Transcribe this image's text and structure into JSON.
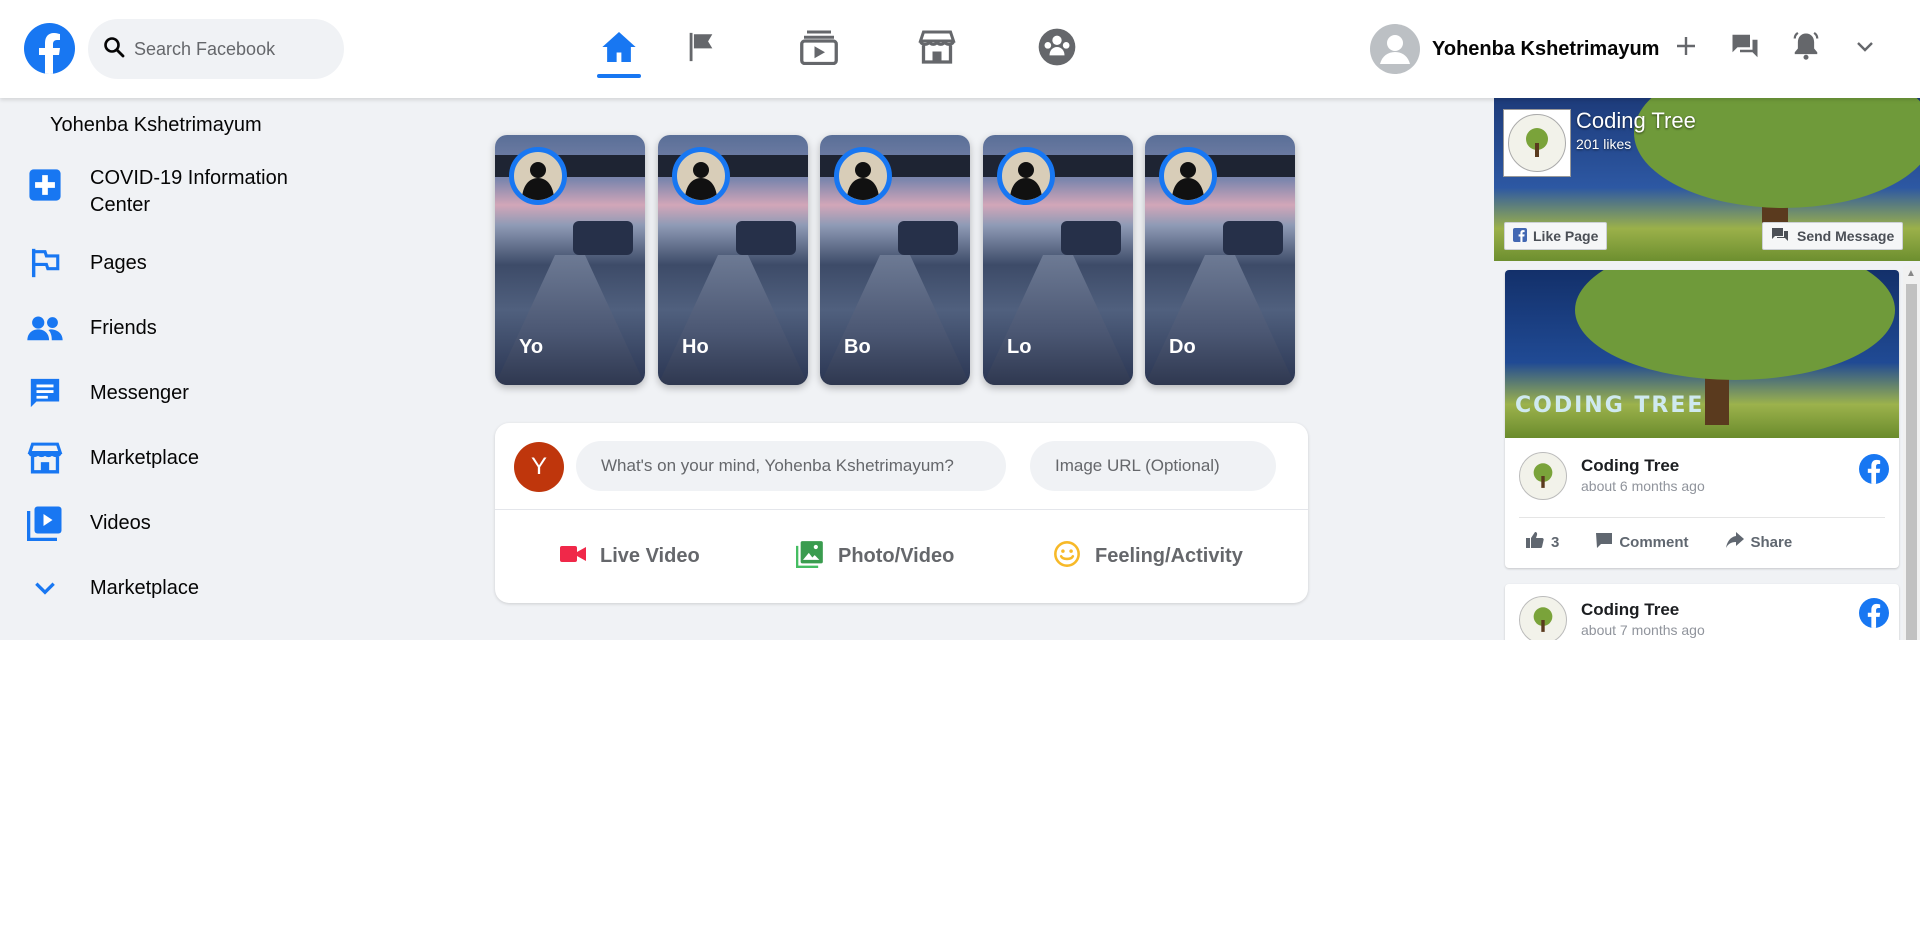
{
  "header": {
    "search_placeholder": "Search Facebook",
    "user_name": "Yohenba Kshetrimayum",
    "nav_tabs": [
      "home-icon",
      "flag-icon",
      "watch-icon",
      "marketplace-icon",
      "groups-icon"
    ],
    "active_tab": "home-icon",
    "accent_color": "#1877f2"
  },
  "sidebar": {
    "user_name": "Yohenba Kshetrimayum",
    "items": [
      {
        "label": "COVID-19 Information Center",
        "icon": "covid-plus-icon"
      },
      {
        "label": "Pages",
        "icon": "flag-icon"
      },
      {
        "label": "Friends",
        "icon": "friends-icon"
      },
      {
        "label": "Messenger",
        "icon": "messenger-icon"
      },
      {
        "label": "Marketplace",
        "icon": "marketplace-icon"
      },
      {
        "label": "Videos",
        "icon": "videos-icon"
      },
      {
        "label": "Marketplace",
        "icon": "chevron-down-icon"
      }
    ]
  },
  "stories": [
    {
      "name": "Yo"
    },
    {
      "name": "Ho"
    },
    {
      "name": "Bo"
    },
    {
      "name": "Lo"
    },
    {
      "name": "Do"
    }
  ],
  "composer": {
    "avatar_letter": "Y",
    "avatar_color": "#bf360c",
    "text_placeholder": "What's on your mind, Yohenba Kshetrimayum?",
    "image_placeholder": "Image URL (Optional)",
    "actions": [
      {
        "label": "Live Video",
        "icon": "live-video-icon",
        "color": "#f02849"
      },
      {
        "label": "Photo/Video",
        "icon": "photo-icon",
        "color": "#45bd62"
      },
      {
        "label": "Feeling/Activity",
        "icon": "feeling-icon",
        "color": "#f7b928"
      }
    ]
  },
  "page_widget": {
    "page_name": "Coding Tree",
    "likes": "201 likes",
    "like_button": "Like Page",
    "message_button": "Send Message",
    "banner_text": "CODING TREE",
    "posts": [
      {
        "author": "Coding Tree",
        "time": "about 6 months ago",
        "like_count": "3",
        "comment_label": "Comment",
        "share_label": "Share"
      },
      {
        "author": "Coding Tree",
        "time": "about 7 months ago"
      }
    ]
  }
}
